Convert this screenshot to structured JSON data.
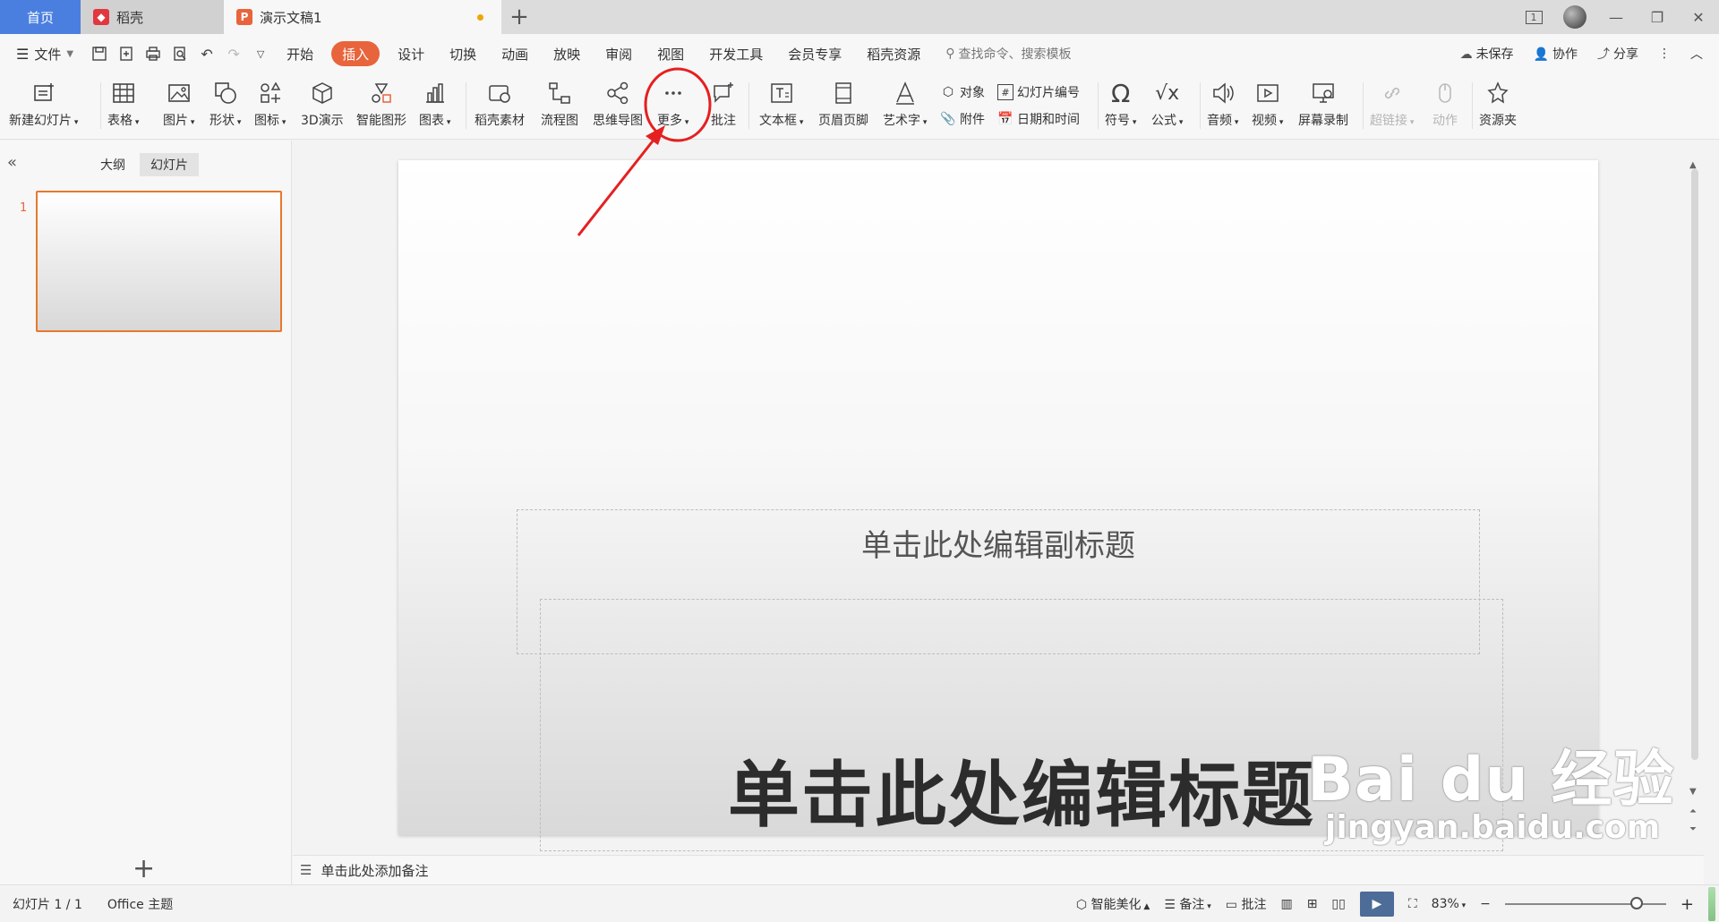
{
  "tabs": {
    "home": "首页",
    "daoke": "稻壳",
    "doc": "演示文稿1",
    "add": "+"
  },
  "window": {
    "view_badge": "1",
    "minimize": "—",
    "restore": "❐",
    "close": "✕"
  },
  "menubar": {
    "file": "文件",
    "items": [
      "开始",
      "插入",
      "设计",
      "切换",
      "动画",
      "放映",
      "审阅",
      "视图",
      "开发工具",
      "会员专享",
      "稻壳资源"
    ],
    "active": "插入",
    "search_placeholder": "查找命令、搜索模板",
    "unsaved": "未保存",
    "collab": "协作",
    "share": "分享"
  },
  "ribbon": {
    "new_slide": "新建幻灯片",
    "table": "表格",
    "picture": "图片",
    "shape": "形状",
    "icon": "图标",
    "three_d": "3D演示",
    "smart_art": "智能图形",
    "chart": "图表",
    "daoke_material": "稻壳素材",
    "flowchart": "流程图",
    "mindmap": "思维导图",
    "more": "更多",
    "comment": "批注",
    "textbox": "文本框",
    "header_footer": "页眉页脚",
    "wordart": "艺术字",
    "object": "对象",
    "attachment": "附件",
    "slide_number": "幻灯片编号",
    "date_time": "日期和时间",
    "symbol": "符号",
    "formula": "公式",
    "audio": "音频",
    "video": "视频",
    "screen_record": "屏幕录制",
    "hyperlink": "超链接",
    "action": "动作",
    "resource": "资源夹"
  },
  "leftpane": {
    "outline_tab": "大纲",
    "slides_tab": "幻灯片",
    "slide_number": "1",
    "add": "+"
  },
  "slide": {
    "subtitle_placeholder": "单击此处编辑副标题",
    "title_placeholder": "单击此处编辑标题"
  },
  "notes": {
    "placeholder": "单击此处添加备注"
  },
  "statusbar": {
    "slide_count": "幻灯片 1 / 1",
    "theme": "Office 主题",
    "beautify": "智能美化",
    "notes": "备注",
    "comments": "批注",
    "zoom": "83%",
    "zoom_minus": "−",
    "zoom_plus": "+"
  },
  "watermark": {
    "brand": "Bai du 经验",
    "url": "jingyan.baidu.com"
  },
  "colors": {
    "accent": "#e8643c",
    "home_tab": "#4a7fe0",
    "annotation": "#e52020"
  }
}
